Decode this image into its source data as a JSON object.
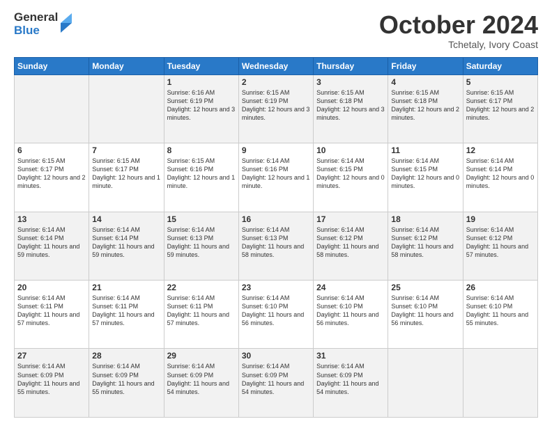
{
  "logo": {
    "general": "General",
    "blue": "Blue"
  },
  "title": "October 2024",
  "subtitle": "Tchetaly, Ivory Coast",
  "weekdays": [
    "Sunday",
    "Monday",
    "Tuesday",
    "Wednesday",
    "Thursday",
    "Friday",
    "Saturday"
  ],
  "weeks": [
    [
      {
        "day": "",
        "info": ""
      },
      {
        "day": "",
        "info": ""
      },
      {
        "day": "1",
        "info": "Sunrise: 6:16 AM\nSunset: 6:19 PM\nDaylight: 12 hours and 3 minutes."
      },
      {
        "day": "2",
        "info": "Sunrise: 6:15 AM\nSunset: 6:19 PM\nDaylight: 12 hours and 3 minutes."
      },
      {
        "day": "3",
        "info": "Sunrise: 6:15 AM\nSunset: 6:18 PM\nDaylight: 12 hours and 3 minutes."
      },
      {
        "day": "4",
        "info": "Sunrise: 6:15 AM\nSunset: 6:18 PM\nDaylight: 12 hours and 2 minutes."
      },
      {
        "day": "5",
        "info": "Sunrise: 6:15 AM\nSunset: 6:17 PM\nDaylight: 12 hours and 2 minutes."
      }
    ],
    [
      {
        "day": "6",
        "info": "Sunrise: 6:15 AM\nSunset: 6:17 PM\nDaylight: 12 hours and 2 minutes."
      },
      {
        "day": "7",
        "info": "Sunrise: 6:15 AM\nSunset: 6:17 PM\nDaylight: 12 hours and 1 minute."
      },
      {
        "day": "8",
        "info": "Sunrise: 6:15 AM\nSunset: 6:16 PM\nDaylight: 12 hours and 1 minute."
      },
      {
        "day": "9",
        "info": "Sunrise: 6:14 AM\nSunset: 6:16 PM\nDaylight: 12 hours and 1 minute."
      },
      {
        "day": "10",
        "info": "Sunrise: 6:14 AM\nSunset: 6:15 PM\nDaylight: 12 hours and 0 minutes."
      },
      {
        "day": "11",
        "info": "Sunrise: 6:14 AM\nSunset: 6:15 PM\nDaylight: 12 hours and 0 minutes."
      },
      {
        "day": "12",
        "info": "Sunrise: 6:14 AM\nSunset: 6:14 PM\nDaylight: 12 hours and 0 minutes."
      }
    ],
    [
      {
        "day": "13",
        "info": "Sunrise: 6:14 AM\nSunset: 6:14 PM\nDaylight: 11 hours and 59 minutes."
      },
      {
        "day": "14",
        "info": "Sunrise: 6:14 AM\nSunset: 6:14 PM\nDaylight: 11 hours and 59 minutes."
      },
      {
        "day": "15",
        "info": "Sunrise: 6:14 AM\nSunset: 6:13 PM\nDaylight: 11 hours and 59 minutes."
      },
      {
        "day": "16",
        "info": "Sunrise: 6:14 AM\nSunset: 6:13 PM\nDaylight: 11 hours and 58 minutes."
      },
      {
        "day": "17",
        "info": "Sunrise: 6:14 AM\nSunset: 6:12 PM\nDaylight: 11 hours and 58 minutes."
      },
      {
        "day": "18",
        "info": "Sunrise: 6:14 AM\nSunset: 6:12 PM\nDaylight: 11 hours and 58 minutes."
      },
      {
        "day": "19",
        "info": "Sunrise: 6:14 AM\nSunset: 6:12 PM\nDaylight: 11 hours and 57 minutes."
      }
    ],
    [
      {
        "day": "20",
        "info": "Sunrise: 6:14 AM\nSunset: 6:11 PM\nDaylight: 11 hours and 57 minutes."
      },
      {
        "day": "21",
        "info": "Sunrise: 6:14 AM\nSunset: 6:11 PM\nDaylight: 11 hours and 57 minutes."
      },
      {
        "day": "22",
        "info": "Sunrise: 6:14 AM\nSunset: 6:11 PM\nDaylight: 11 hours and 57 minutes."
      },
      {
        "day": "23",
        "info": "Sunrise: 6:14 AM\nSunset: 6:10 PM\nDaylight: 11 hours and 56 minutes."
      },
      {
        "day": "24",
        "info": "Sunrise: 6:14 AM\nSunset: 6:10 PM\nDaylight: 11 hours and 56 minutes."
      },
      {
        "day": "25",
        "info": "Sunrise: 6:14 AM\nSunset: 6:10 PM\nDaylight: 11 hours and 56 minutes."
      },
      {
        "day": "26",
        "info": "Sunrise: 6:14 AM\nSunset: 6:10 PM\nDaylight: 11 hours and 55 minutes."
      }
    ],
    [
      {
        "day": "27",
        "info": "Sunrise: 6:14 AM\nSunset: 6:09 PM\nDaylight: 11 hours and 55 minutes."
      },
      {
        "day": "28",
        "info": "Sunrise: 6:14 AM\nSunset: 6:09 PM\nDaylight: 11 hours and 55 minutes."
      },
      {
        "day": "29",
        "info": "Sunrise: 6:14 AM\nSunset: 6:09 PM\nDaylight: 11 hours and 54 minutes."
      },
      {
        "day": "30",
        "info": "Sunrise: 6:14 AM\nSunset: 6:09 PM\nDaylight: 11 hours and 54 minutes."
      },
      {
        "day": "31",
        "info": "Sunrise: 6:14 AM\nSunset: 6:09 PM\nDaylight: 11 hours and 54 minutes."
      },
      {
        "day": "",
        "info": ""
      },
      {
        "day": "",
        "info": ""
      }
    ]
  ]
}
